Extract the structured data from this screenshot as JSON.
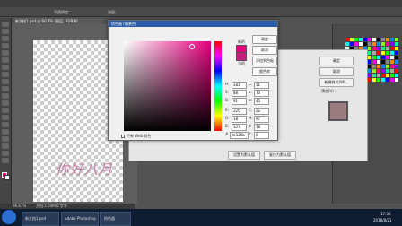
{
  "app": {
    "doc_tab": "新文档1.psd @ 66.7% (图层, RGB/8)",
    "opt_label1": "不透明度:",
    "opt_label2": "流量:"
  },
  "picker": {
    "title": "拾色器 (前景色)",
    "new_label": "新的",
    "current_label": "当前",
    "ok": "确定",
    "cancel": "取消",
    "add_swatch": "添加到色板",
    "libraries": "颜色库",
    "only_web": "只有 Web 颜色",
    "fields": {
      "H": "282",
      "S": "88",
      "B": "91",
      "L": "51",
      "a": "73",
      "b": "45",
      "R": "220",
      "G": "18",
      "Bl": "107",
      "C": "22",
      "M": "97",
      "Y": "18",
      "K": "0",
      "hex": "dc126b"
    },
    "units": {
      "deg": "度",
      "pct": "%"
    }
  },
  "layer_dialog": {
    "title": "图层样式",
    "btn_default": "设置为默认值",
    "btn_reset": "复位为默认值",
    "ok": "确定",
    "cancel": "取消",
    "new_style": "新建样式(W)...",
    "preview": "预览(V)",
    "items": [
      "图案叠加",
      "外发光",
      "投影"
    ]
  },
  "signature": "你好八月",
  "status": {
    "zoom": "66.67%",
    "doc": "文档:1.04M/0 字节"
  },
  "taskbar": {
    "items": [
      "新文档1.psd",
      "Adobe Photoshop",
      "拾色器"
    ],
    "time": "17:36",
    "date": "2018/8/21"
  },
  "colors": {
    "accent": "#e6007e",
    "title_bar": "#2b5aa8"
  }
}
